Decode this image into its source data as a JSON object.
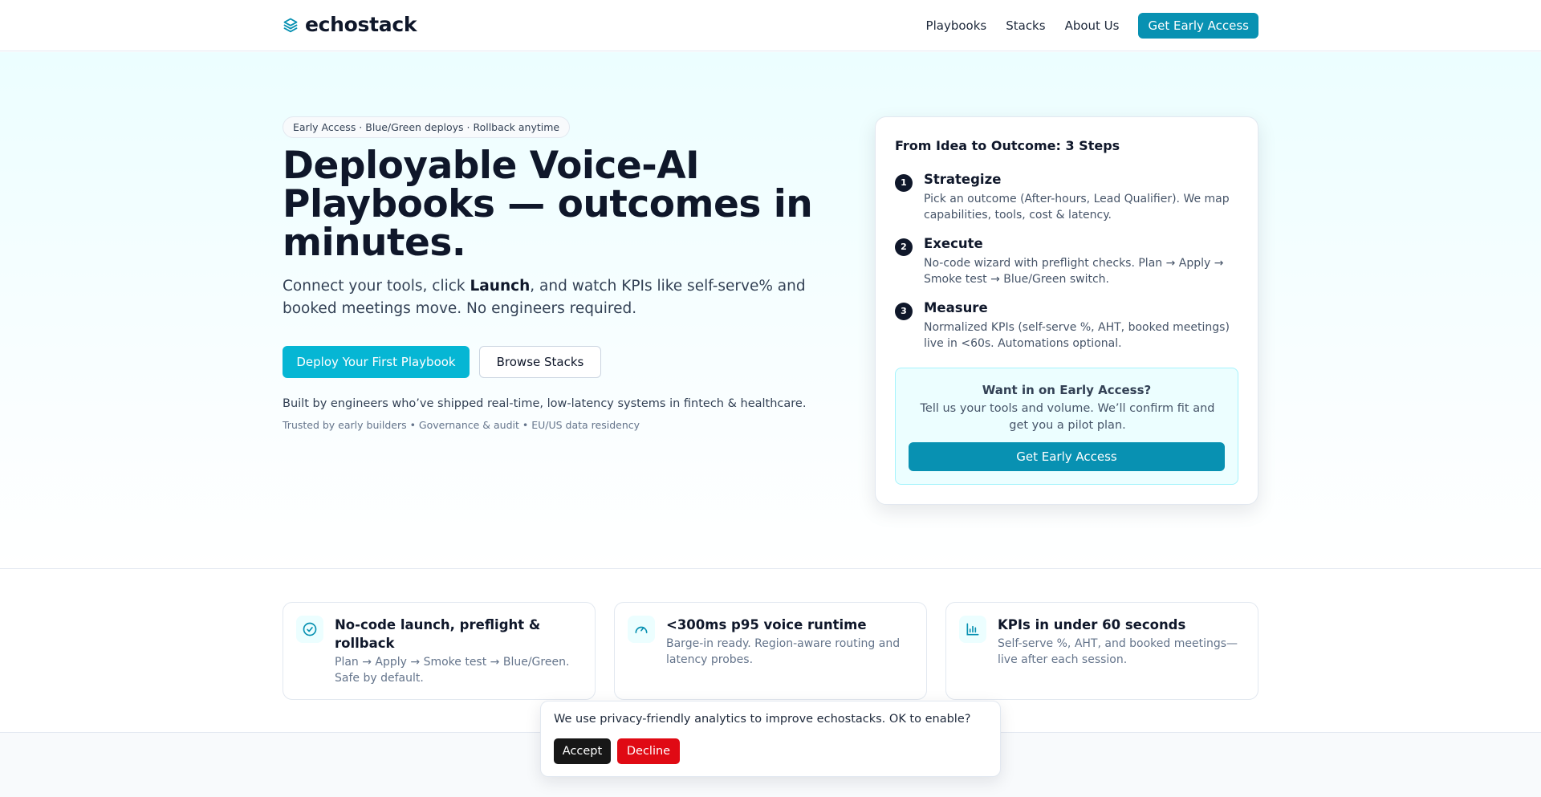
{
  "header": {
    "logo_text": "echostack",
    "nav": [
      "Playbooks",
      "Stacks",
      "About Us"
    ],
    "cta": "Get Early Access"
  },
  "hero": {
    "pill": "Early Access · Blue/Green deploys · Rollback anytime",
    "title": "Deployable Voice-AI Playbooks — outcomes in minutes.",
    "subtitle_before": "Connect your tools, click ",
    "subtitle_bold": "Launch",
    "subtitle_after": ", and watch KPIs like self-serve% and booked meetings move. No engineers required.",
    "primary_button": "Deploy Your First Playbook",
    "secondary_button": "Browse Stacks",
    "built_by": "Built by engineers who’ve shipped real-time, low-latency systems in fintech & healthcare.",
    "trusted": "Trusted by early builders • Governance & audit • EU/US data residency"
  },
  "steps_card": {
    "title": "From Idea to Outcome: 3 Steps",
    "steps": [
      {
        "num": "1",
        "title": "Strategize",
        "desc": "Pick an outcome (After-hours, Lead Qualifier). We map capabilities, tools, cost & latency."
      },
      {
        "num": "2",
        "title": "Execute",
        "desc": "No-code wizard with preflight checks. Plan → Apply → Smoke test → Blue/Green switch."
      },
      {
        "num": "3",
        "title": "Measure",
        "desc": "Normalized KPIs (self-serve %, AHT, booked meetings) live in <60s. Automations optional."
      }
    ],
    "early_access": {
      "title": "Want in on Early Access?",
      "desc": "Tell us your tools and volume. We’ll confirm fit and get you a pilot plan.",
      "button": "Get Early Access"
    }
  },
  "features": [
    {
      "icon": "check-circle-icon",
      "title": "No-code launch, preflight & rollback",
      "desc": "Plan → Apply → Smoke test → Blue/Green. Safe by default."
    },
    {
      "icon": "gauge-icon",
      "title": "<300ms p95 voice runtime",
      "desc": "Barge-in ready. Region-aware routing and latency probes."
    },
    {
      "icon": "bar-chart-icon",
      "title": "KPIs in under 60 seconds",
      "desc": "Self-serve %, AHT, and booked meetings—live after each session."
    }
  ],
  "cookie": {
    "text": "We use privacy-friendly analytics to improve echostacks. OK to enable?",
    "accept": "Accept",
    "decline": "Decline"
  },
  "colors": {
    "accent": "#06b6d4",
    "accent_dark": "#0891b2",
    "decline": "#e00a14"
  }
}
